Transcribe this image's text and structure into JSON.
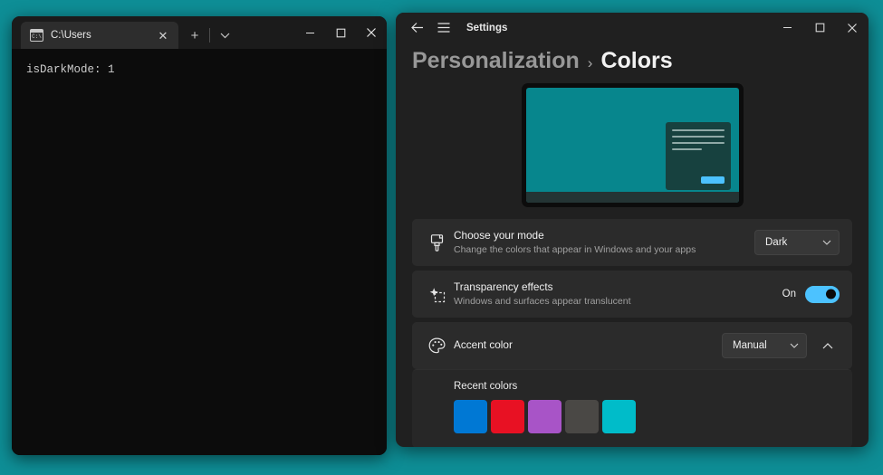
{
  "desktop": {
    "background_color": "#0e8e96"
  },
  "terminal": {
    "tab": {
      "title": "C:\\Users",
      "icon": "command-prompt-icon",
      "icon_glyph": "C:\\",
      "close_glyph": "✕"
    },
    "new_tab_glyph": "+",
    "dropdown_glyph": "⌵",
    "window_controls": {
      "minimize": "─",
      "maximize": "□",
      "close": "✕"
    },
    "output_line": "isDarkMode: 1"
  },
  "settings": {
    "titlebar": {
      "back_glyph": "←",
      "menu_glyph": "☰",
      "title": "Settings",
      "minimize": "─",
      "maximize": "□",
      "close": "✕"
    },
    "breadcrumb": {
      "parent": "Personalization",
      "separator": "›",
      "current": "Colors"
    },
    "preview": {
      "desktop_color": "#07868d",
      "window_color": "#17413f",
      "accent_button_color": "#4cc2ff",
      "taskbar_color": "#243434"
    },
    "rows": [
      {
        "icon": "paintbrush-icon",
        "title": "Choose your mode",
        "subtitle": "Change the colors that appear in Windows and your apps",
        "control": "dropdown",
        "value": "Dark"
      },
      {
        "icon": "transparency-icon",
        "title": "Transparency effects",
        "subtitle": "Windows and surfaces appear translucent",
        "control": "toggle",
        "value": "On"
      },
      {
        "icon": "palette-icon",
        "title": "Accent color",
        "subtitle": "",
        "control": "dropdown-expander",
        "value": "Manual"
      }
    ],
    "accent_panel": {
      "heading": "Recent colors",
      "swatches": [
        {
          "name": "blue",
          "color": "#0078d4"
        },
        {
          "name": "red",
          "color": "#e81123"
        },
        {
          "name": "purple",
          "color": "#a854c7"
        },
        {
          "name": "gray",
          "color": "#4a4845"
        },
        {
          "name": "cyan",
          "color": "#00bcc9"
        }
      ]
    }
  }
}
